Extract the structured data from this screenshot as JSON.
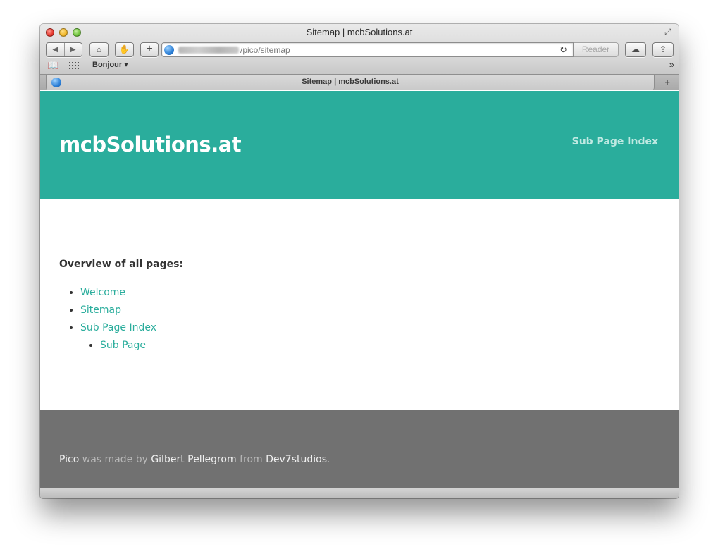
{
  "window": {
    "title": "Sitemap | mcbSolutions.at",
    "icons": {
      "close": "close-light",
      "minimize": "minimize-light",
      "zoom": "zoom-light",
      "fullscreen": "fullscreen-icon"
    }
  },
  "toolbar": {
    "back_icon": "◀",
    "forward_icon": "▶",
    "home_icon": "⌂",
    "hand_icon": "✋",
    "add_icon": "+",
    "url_path": "/pico/sitemap",
    "reload_icon": "↻",
    "reader_label": "Reader",
    "cloud_icon": "☁",
    "share_icon": "⇪"
  },
  "bookmarks": {
    "book_icon": "📖",
    "bonjour_label": "Bonjour ▾",
    "overflow_icon": "»"
  },
  "tab": {
    "title": "Sitemap | mcbSolutions.at",
    "new_tab_icon": "+"
  },
  "site": {
    "logo": "mcbSolutions.at",
    "nav_item": "Sub Page Index",
    "accent_color": "#2aad9c",
    "footer_color": "#717171"
  },
  "content": {
    "intro": "Overview of all pages:",
    "pages": [
      {
        "label": "Welcome"
      },
      {
        "label": "Sitemap"
      },
      {
        "label": "Sub Page Index",
        "children": [
          {
            "label": "Sub Page"
          }
        ]
      }
    ]
  },
  "footer": {
    "link1": "Pico",
    "text1": " was made by ",
    "link2": "Gilbert Pellegrom",
    "text2": " from ",
    "link3": "Dev7studios",
    "text3": "."
  }
}
